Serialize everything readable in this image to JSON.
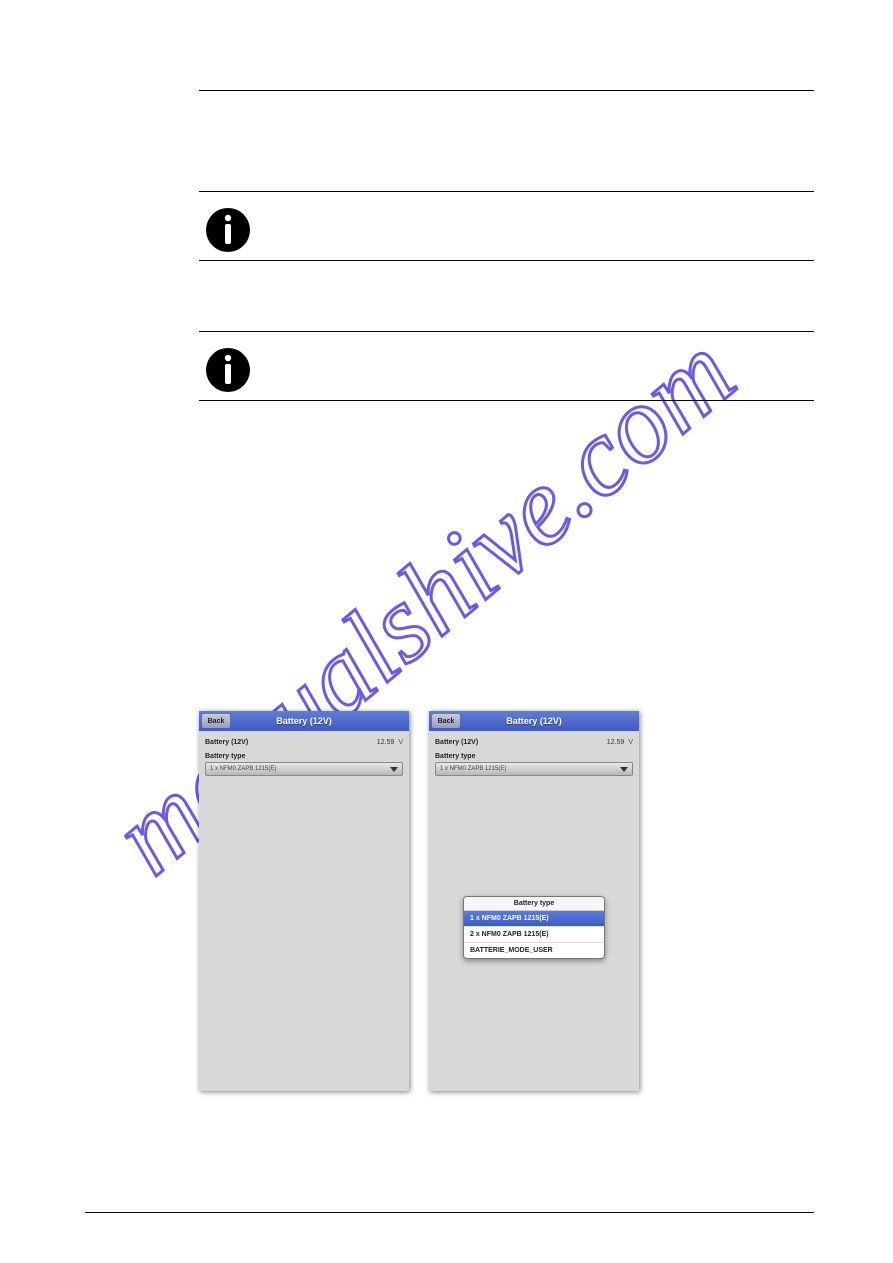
{
  "watermark_text": "manualshive.com",
  "note1": {
    "text": ""
  },
  "note2": {
    "text": ""
  },
  "phone1": {
    "back": "Back",
    "title": "Battery (12V)",
    "row_label": "Battery (12V)",
    "row_value": "12.59",
    "row_unit": "V",
    "label2": "Battery type",
    "select_value": "1 x NFM0 ZAPB 1215(E)"
  },
  "phone2": {
    "back": "Back",
    "title": "Battery (12V)",
    "row_label": "Battery (12V)",
    "row_value": "12.59",
    "row_unit": "V",
    "label2": "Battery type",
    "select_value": "1 x NFM0 ZAPB 1215(E)",
    "popup_title": "Battery type",
    "popup_items": [
      "1 x NFM0 ZAPB 1215(E)",
      "2 x NFM0 ZAPB 1215(E)",
      "BATTERIE_MODE_USER"
    ]
  }
}
